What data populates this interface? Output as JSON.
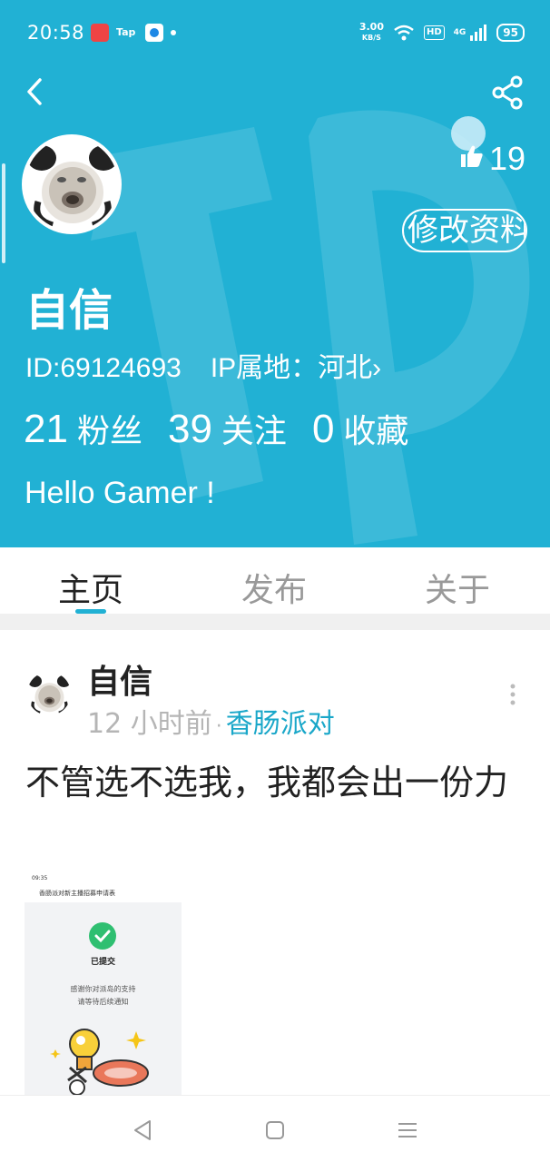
{
  "status_bar": {
    "time": "20:58",
    "tap_label": "Tap",
    "net_speed_value": "3.00",
    "net_speed_unit": "KB/S",
    "hd": "HD",
    "network": "4G",
    "battery": "95"
  },
  "profile": {
    "likes": "19",
    "edit_button": "修改资料",
    "username": "自信",
    "id_text": "ID:69124693",
    "ip_text": "IP属地：河北",
    "ip_chevron": "›",
    "followers_count": "21",
    "followers_label": "粉丝",
    "following_count": "39",
    "following_label": "关注",
    "favorites_count": "0",
    "favorites_label": "收藏",
    "bio": "Hello Gamer !"
  },
  "tabs": [
    {
      "label": "主页"
    },
    {
      "label": "发布"
    },
    {
      "label": "关于"
    }
  ],
  "post": {
    "author": "自信",
    "time": "12 小时前",
    "separator": "·",
    "tag": "香肠派对",
    "text": "不管选不选我，我都会出一份力",
    "image": {
      "status_time": "09:35",
      "title": "香肠派对新主播招募申请表",
      "done_label": "已提交",
      "msg_line1": "感谢你对派岛的支持",
      "msg_line2": "请等待后续通知"
    }
  },
  "colors": {
    "header_bg": "#21b1d4",
    "accent": "#1aa7c9"
  }
}
